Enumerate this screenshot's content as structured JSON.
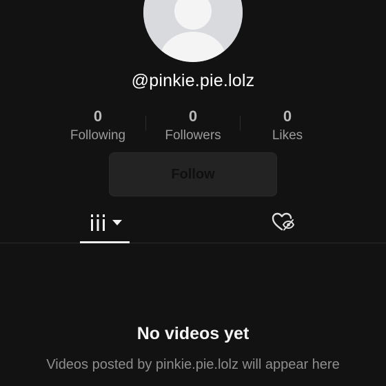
{
  "profile": {
    "username": "@pinkie.pie.lolz",
    "avatar_icon": "default-avatar-icon"
  },
  "stats": [
    {
      "value": "0",
      "label": "Following"
    },
    {
      "value": "0",
      "label": "Followers"
    },
    {
      "value": "0",
      "label": "Likes"
    }
  ],
  "actions": {
    "follow_label": "Follow"
  },
  "tabs": [
    {
      "name": "videos",
      "icon": "grid-icon",
      "dropdown_icon": "caret-down-icon",
      "active": true
    },
    {
      "name": "liked",
      "icon": "hidden-liked-heart-icon",
      "active": false
    }
  ],
  "empty_state": {
    "title": "No videos yet",
    "subtitle": "Videos posted by pinkie.pie.lolz will appear here"
  },
  "colors": {
    "background": "#121212",
    "text_primary": "#ffffff",
    "text_secondary": "#9b9b9b",
    "button_bg": "#232323"
  }
}
